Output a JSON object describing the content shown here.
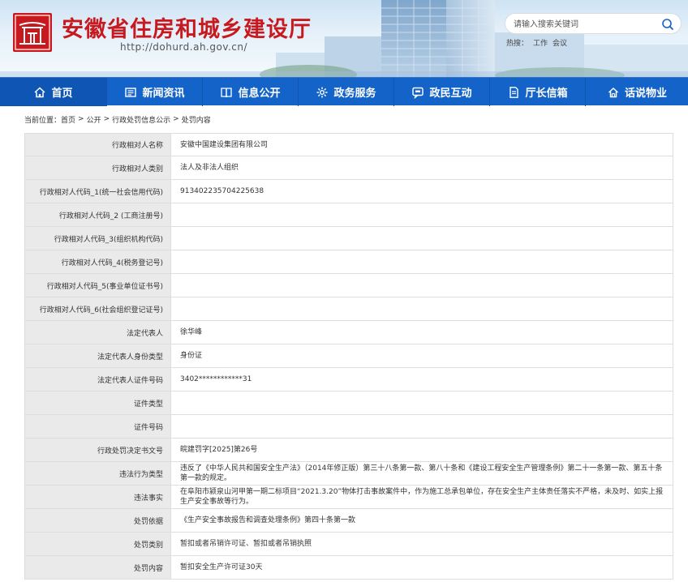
{
  "header": {
    "title": "安徽省住房和城乡建设厅",
    "url": "http://dohurd.ah.gov.cn/",
    "search_placeholder": "请输入搜索关键词",
    "hot_label": "热搜：",
    "hot_words": [
      "工作",
      "会议"
    ]
  },
  "nav": {
    "items": [
      {
        "label": "首页",
        "icon": "home-icon"
      },
      {
        "label": "新闻资讯",
        "icon": "news-icon"
      },
      {
        "label": "信息公开",
        "icon": "book-icon"
      },
      {
        "label": "政务服务",
        "icon": "service-icon"
      },
      {
        "label": "政民互动",
        "icon": "chat-icon"
      },
      {
        "label": "厅长信箱",
        "icon": "mail-icon"
      },
      {
        "label": "话说物业",
        "icon": "house-icon"
      }
    ]
  },
  "breadcrumb": {
    "prefix": "当前位置：",
    "items": [
      "首页",
      "公开",
      "行政处罚信息公示",
      "处罚内容"
    ],
    "separator": ">"
  },
  "details": [
    {
      "label": "行政相对人名称",
      "value": "安徽中国建设集团有限公司"
    },
    {
      "label": "行政相对人类别",
      "value": "法人及非法人组织"
    },
    {
      "label": "行政相对人代码_1(统一社会信用代码)",
      "value": "913402235704225638"
    },
    {
      "label": "行政相对人代码_2 (工商注册号)",
      "value": ""
    },
    {
      "label": "行政相对人代码_3(组织机构代码)",
      "value": ""
    },
    {
      "label": "行政相对人代码_4(税务登记号)",
      "value": ""
    },
    {
      "label": "行政相对人代码_5(事业单位证书号)",
      "value": ""
    },
    {
      "label": "行政相对人代码_6(社会组织登记证号)",
      "value": ""
    },
    {
      "label": "法定代表人",
      "value": "徐华峰"
    },
    {
      "label": "法定代表人身份类型",
      "value": "身份证"
    },
    {
      "label": "法定代表人证件号码",
      "value": "3402************31"
    },
    {
      "label": "证件类型",
      "value": ""
    },
    {
      "label": "证件号码",
      "value": ""
    },
    {
      "label": "行政处罚决定书文号",
      "value": "皖建罚字[2025]第26号"
    },
    {
      "label": "违法行为类型",
      "value": "违反了《中华人民共和国安全生产法》（2014年修正版）第三十八条第一款、第八十条和《建设工程安全生产管理条例》第二十一条第一款、第五十条第一款的规定。"
    },
    {
      "label": "违法事实",
      "value": "在阜阳市颍泉山河甲第一期二标项目“2021.3.20”物体打击事故案件中，作为施工总承包单位，存在安全生产主体责任落实不严格，未及时、如实上报生产安全事故等行为。"
    },
    {
      "label": "处罚依据",
      "value": "《生产安全事故报告和调查处理条例》第四十条第一款"
    },
    {
      "label": "处罚类别",
      "value": "暂扣或者吊销许可证、暂扣或者吊销执照"
    },
    {
      "label": "处罚内容",
      "value": "暂扣安全生产许可证30天"
    }
  ],
  "colors": {
    "title_red": "#c8191f",
    "nav_blue": "#1463c8",
    "label_bg": "#eaeaea"
  }
}
